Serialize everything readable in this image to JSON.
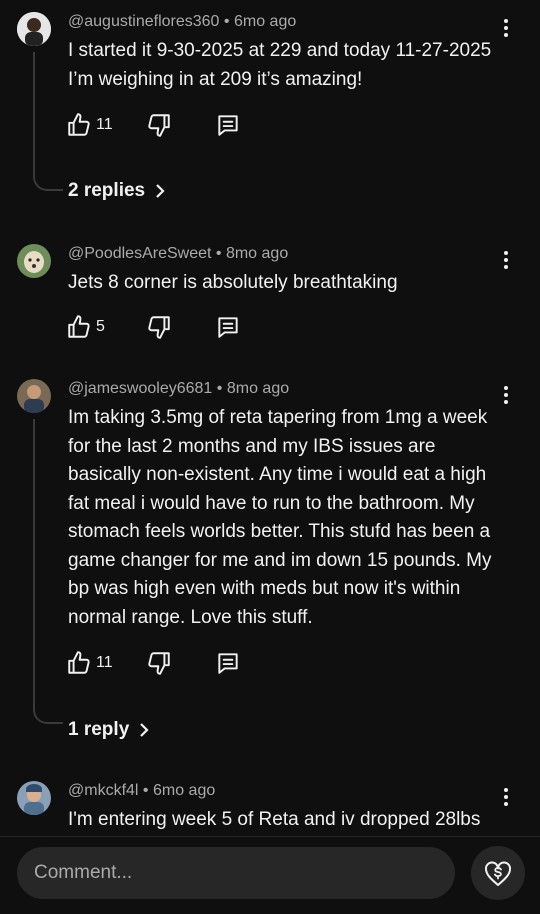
{
  "comments": [
    {
      "author": "@augustineflores360",
      "time": "6mo ago",
      "text": "I started it 9-30-2025 at 229 and today 11-27-2025 I’m weighing in at 209 it’s amazing!",
      "likes": "11",
      "replies": "2 replies"
    },
    {
      "author": "@PoodlesAreSweet",
      "time": "8mo ago",
      "text": "Jets 8 corner is absolutely breathtaking",
      "likes": "5"
    },
    {
      "author": "@jameswooley6681",
      "time": "8mo ago",
      "text": "Im taking 3.5mg of reta tapering from 1mg a week for the last 2 months and my IBS issues are basically non-existent. Any time i would eat a high fat meal i would have to run to the bathroom. My stomach feels worlds better. This stufd has been a game changer for me and im down 15 pounds. My bp was high even with meds but now it's within normal range. Love this stuff.",
      "likes": "11",
      "replies": "1 reply"
    },
    {
      "author": "@mkckf4l",
      "time": "6mo ago",
      "text": "I'm entering week 5 of Reta and iv dropped 28lbs"
    }
  ],
  "separator": "•",
  "composer": {
    "placeholder": "Comment...",
    "thanks_icon": "super-thanks-heart-dollar-icon"
  },
  "colors": {
    "background": "#0f0f0f",
    "text": "#f1f1f1",
    "meta": "#aaaaaa",
    "input": "#272727"
  }
}
